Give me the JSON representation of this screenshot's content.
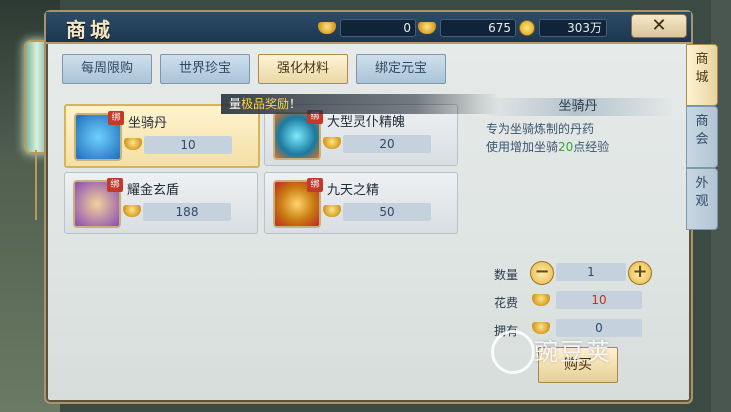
{
  "window": {
    "title": "商城",
    "close_label": "✕"
  },
  "currency": {
    "gold_ingot": "0",
    "bound_ingot": "675",
    "coin": "303万"
  },
  "tabs": [
    {
      "label": "每周限购",
      "active": false
    },
    {
      "label": "世界珍宝",
      "active": false
    },
    {
      "label": "强化材料",
      "active": true
    },
    {
      "label": "绑定元宝",
      "active": false
    }
  ],
  "banner": {
    "prefix": "量",
    "highlight": "极品奖励",
    "suffix": "！"
  },
  "items": [
    {
      "name": "坐骑丹",
      "price": "10",
      "bind_badge": "绑",
      "selected": true
    },
    {
      "name": "大型灵仆精魄",
      "price": "20",
      "bind_badge": "绑",
      "selected": false
    },
    {
      "name": "耀金玄盾",
      "price": "188",
      "bind_badge": "绑",
      "selected": false
    },
    {
      "name": "九天之精",
      "price": "50",
      "bind_badge": "绑",
      "selected": false
    }
  ],
  "detail": {
    "title": "坐骑丹",
    "line1": "专为坐骑炼制的丹药",
    "line2_prefix": "使用增加坐骑",
    "line2_num": "20",
    "line2_suffix": "点经验"
  },
  "purchase": {
    "qty_label": "数量",
    "qty_value": "1",
    "cost_label": "花费",
    "cost_value": "10",
    "owned_label": "拥有",
    "owned_value": "0",
    "buy_label": "购买",
    "minus": "−",
    "plus": "+"
  },
  "side_tabs": [
    {
      "label": "商城",
      "active": true
    },
    {
      "label": "商会",
      "active": false
    },
    {
      "label": "外观",
      "active": false
    }
  ],
  "watermark": "豌豆荚"
}
